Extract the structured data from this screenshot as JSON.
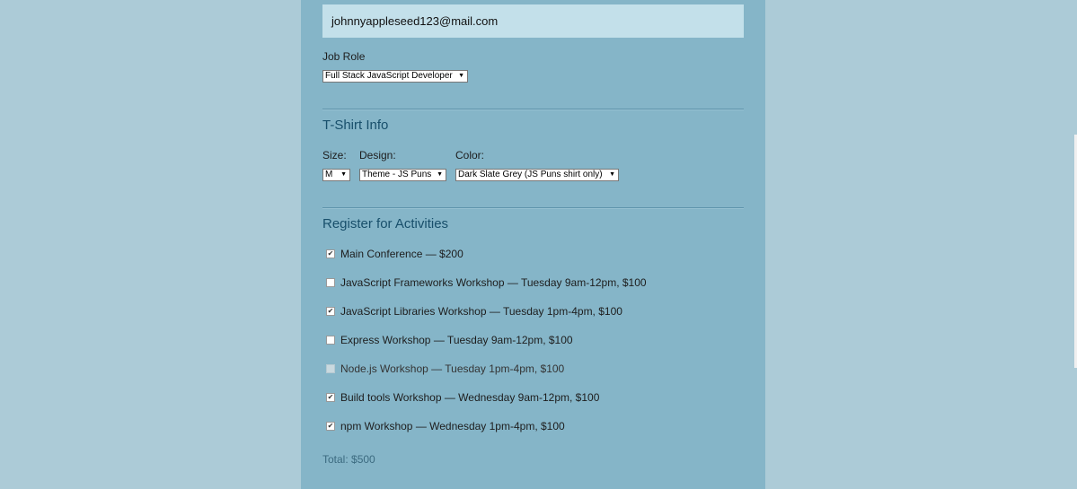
{
  "email": {
    "value": "johnnyappleseed123@mail.com"
  },
  "job_role": {
    "label": "Job Role",
    "selected": "Full Stack JavaScript Developer"
  },
  "tshirt": {
    "title": "T-Shirt Info",
    "size_label": "Size:",
    "size_selected": "M",
    "design_label": "Design:",
    "design_selected": "Theme - JS Puns",
    "color_label": "Color:",
    "color_selected": "Dark Slate Grey (JS Puns shirt only)"
  },
  "activities": {
    "title": "Register for Activities",
    "items": [
      {
        "label": "Main Conference — $200",
        "checked": true,
        "disabled": false
      },
      {
        "label": "JavaScript Frameworks Workshop — Tuesday 9am-12pm, $100",
        "checked": false,
        "disabled": false
      },
      {
        "label": "JavaScript Libraries Workshop — Tuesday 1pm-4pm, $100",
        "checked": true,
        "disabled": false
      },
      {
        "label": "Express Workshop — Tuesday 9am-12pm, $100",
        "checked": false,
        "disabled": false
      },
      {
        "label": "Node.js Workshop — Tuesday 1pm-4pm, $100",
        "checked": false,
        "disabled": true
      },
      {
        "label": "Build tools Workshop — Wednesday 9am-12pm, $100",
        "checked": true,
        "disabled": false
      },
      {
        "label": "npm Workshop — Wednesday 1pm-4pm, $100",
        "checked": true,
        "disabled": false
      }
    ],
    "total": "Total: $500"
  },
  "colors": {
    "page_bg": "#accbd7",
    "panel_bg": "#85b5c8",
    "email_bg": "#c3e0ea",
    "section_title": "#184f6b"
  },
  "icons": {
    "select_arrow": "triangle-down-icon",
    "checkmark": "checkmark-icon"
  }
}
